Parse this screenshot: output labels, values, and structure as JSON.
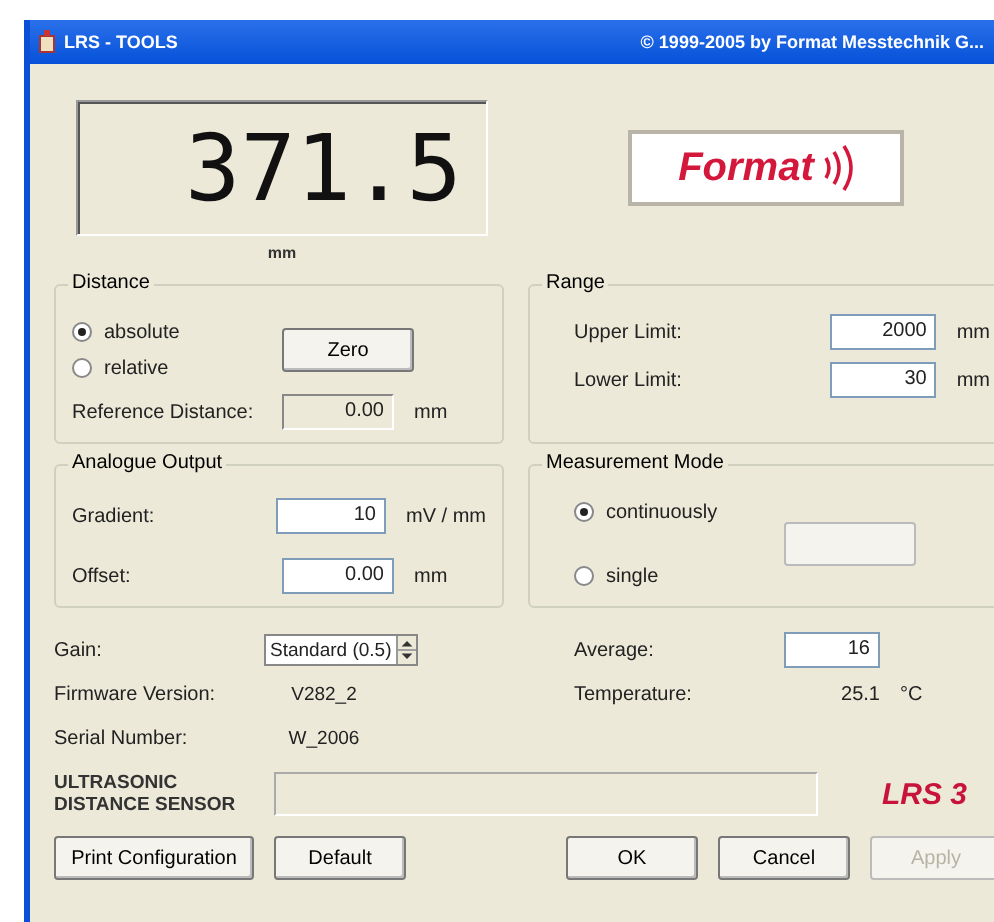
{
  "window": {
    "title": "LRS - TOOLS",
    "copyright": "© 1999-2005 by Format Messtechnik G..."
  },
  "display": {
    "value": "371.5",
    "unit": "mm"
  },
  "logo": {
    "text": "Format"
  },
  "distance": {
    "title": "Distance",
    "modes": [
      {
        "label": "absolute",
        "selected": true
      },
      {
        "label": "relative",
        "selected": false
      }
    ],
    "zero_button": "Zero",
    "reference": {
      "label": "Reference Distance:",
      "value": "0.00",
      "unit": "mm"
    }
  },
  "range": {
    "title": "Range",
    "fields": [
      {
        "label": "Upper Limit:",
        "value": "2000",
        "unit": "mm"
      },
      {
        "label": "Lower Limit:",
        "value": "30",
        "unit": "mm"
      }
    ]
  },
  "analogue_output": {
    "title": "Analogue Output",
    "fields": [
      {
        "label": "Gradient:",
        "value": "10",
        "unit": "mV / mm"
      },
      {
        "label": "Offset:",
        "value": "0.00",
        "unit": "mm"
      }
    ]
  },
  "measurement_mode": {
    "title": "Measurement Mode",
    "modes": [
      {
        "label": "continuously",
        "selected": true
      },
      {
        "label": "single",
        "selected": false
      }
    ],
    "trigger_button": {
      "disabled": true
    }
  },
  "gain": {
    "label": "Gain:",
    "value": "Standard (0.5)"
  },
  "firmware": {
    "label": "Firmware Version:",
    "value": "V282_2"
  },
  "serial": {
    "label": "Serial Number:",
    "value": "W_2006"
  },
  "average": {
    "label": "Average:",
    "value": "16"
  },
  "temperature": {
    "label": "Temperature:",
    "value": "25.1",
    "unit": "°C"
  },
  "sensor_name": "ULTRASONIC DISTANCE SENSOR",
  "model": "LRS 3",
  "buttons": [
    {
      "label": "Print Configuration",
      "disabled": false
    },
    {
      "label": "Default",
      "disabled": false
    },
    {
      "label": "OK",
      "disabled": false
    },
    {
      "label": "Cancel",
      "disabled": false
    },
    {
      "label": "Apply",
      "disabled": true
    }
  ]
}
